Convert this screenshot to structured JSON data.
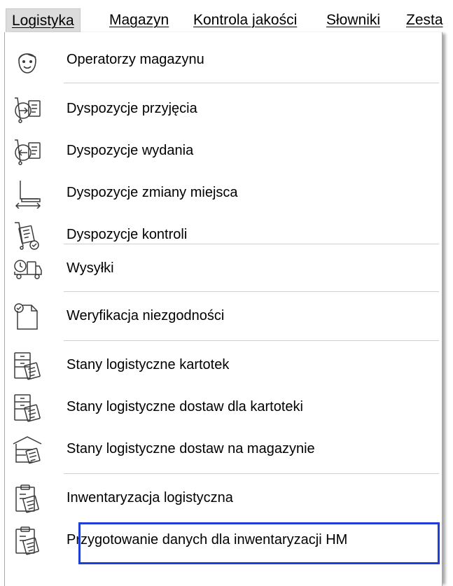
{
  "menubar": {
    "items": [
      {
        "label": "Logistyka",
        "active": true
      },
      {
        "label": "Magazyn"
      },
      {
        "label": "Kontrola jakości"
      },
      {
        "label": "Słowniki"
      },
      {
        "label": "Zesta"
      }
    ]
  },
  "dropdown": {
    "items": [
      {
        "label": "Operatorzy magazynu",
        "icon": "operator-face-icon"
      },
      {
        "label": "Dyspozycje przyjęcia",
        "icon": "receipt-disposition-icon"
      },
      {
        "label": "Dyspozycje wydania",
        "icon": "issue-disposition-icon"
      },
      {
        "label": "Dyspozycje zmiany miejsca",
        "icon": "relocation-disposition-icon"
      },
      {
        "label": "Dyspozycje kontroli",
        "icon": "control-disposition-icon"
      },
      {
        "label": "Wysyłki",
        "icon": "shipment-truck-icon"
      },
      {
        "label": "Weryfikacja niezgodności",
        "icon": "discrepancy-document-icon"
      },
      {
        "label": "Stany logistyczne kartotek",
        "icon": "stock-cards-icon"
      },
      {
        "label": "Stany logistyczne dostaw dla kartoteki",
        "icon": "stock-deliveries-icon"
      },
      {
        "label": "Stany logistyczne dostaw na magazynie",
        "icon": "warehouse-deliveries-icon"
      },
      {
        "label": "Inwentaryzacja logistyczna",
        "icon": "inventory-clipboard-icon"
      },
      {
        "label": "Przygotowanie danych dla inwentaryzacji HM",
        "icon": "inventory-prep-clipboard-icon",
        "selected": true
      }
    ]
  },
  "colors": {
    "selection_border": "#1e3fd6",
    "active_menu_bg": "#dcdcdc",
    "separator": "#cfcfcf"
  }
}
